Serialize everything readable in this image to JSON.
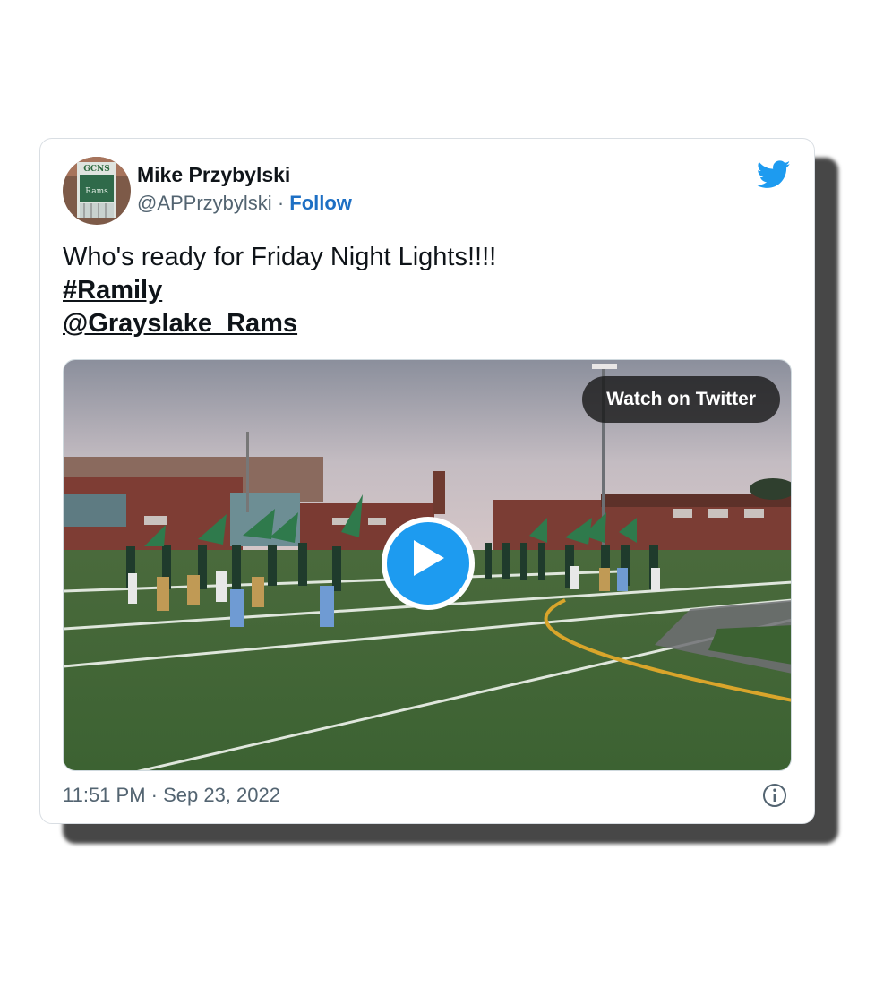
{
  "tweet": {
    "author_name": "Mike Przybylski",
    "author_handle": "@APPrzybylski",
    "separator": " · ",
    "follow_label": "Follow",
    "text": "Who's ready for Friday Night Lights!!!!",
    "hashtag": "#Ramily",
    "mention": "@Grayslake_Rams",
    "timestamp": "11:51 PM · Sep 23, 2022"
  },
  "avatar": {
    "sign_text": "GCNS",
    "logo_text": "Rams"
  },
  "media": {
    "watch_label": "Watch on Twitter"
  },
  "icons": {
    "brand": "twitter-bird-icon",
    "play": "play-icon",
    "info": "info-icon"
  },
  "colors": {
    "twitter_blue": "#1d9bf0",
    "follow_link": "#1d6fc4",
    "muted_text": "#536471",
    "primary_text": "#0f1419"
  }
}
